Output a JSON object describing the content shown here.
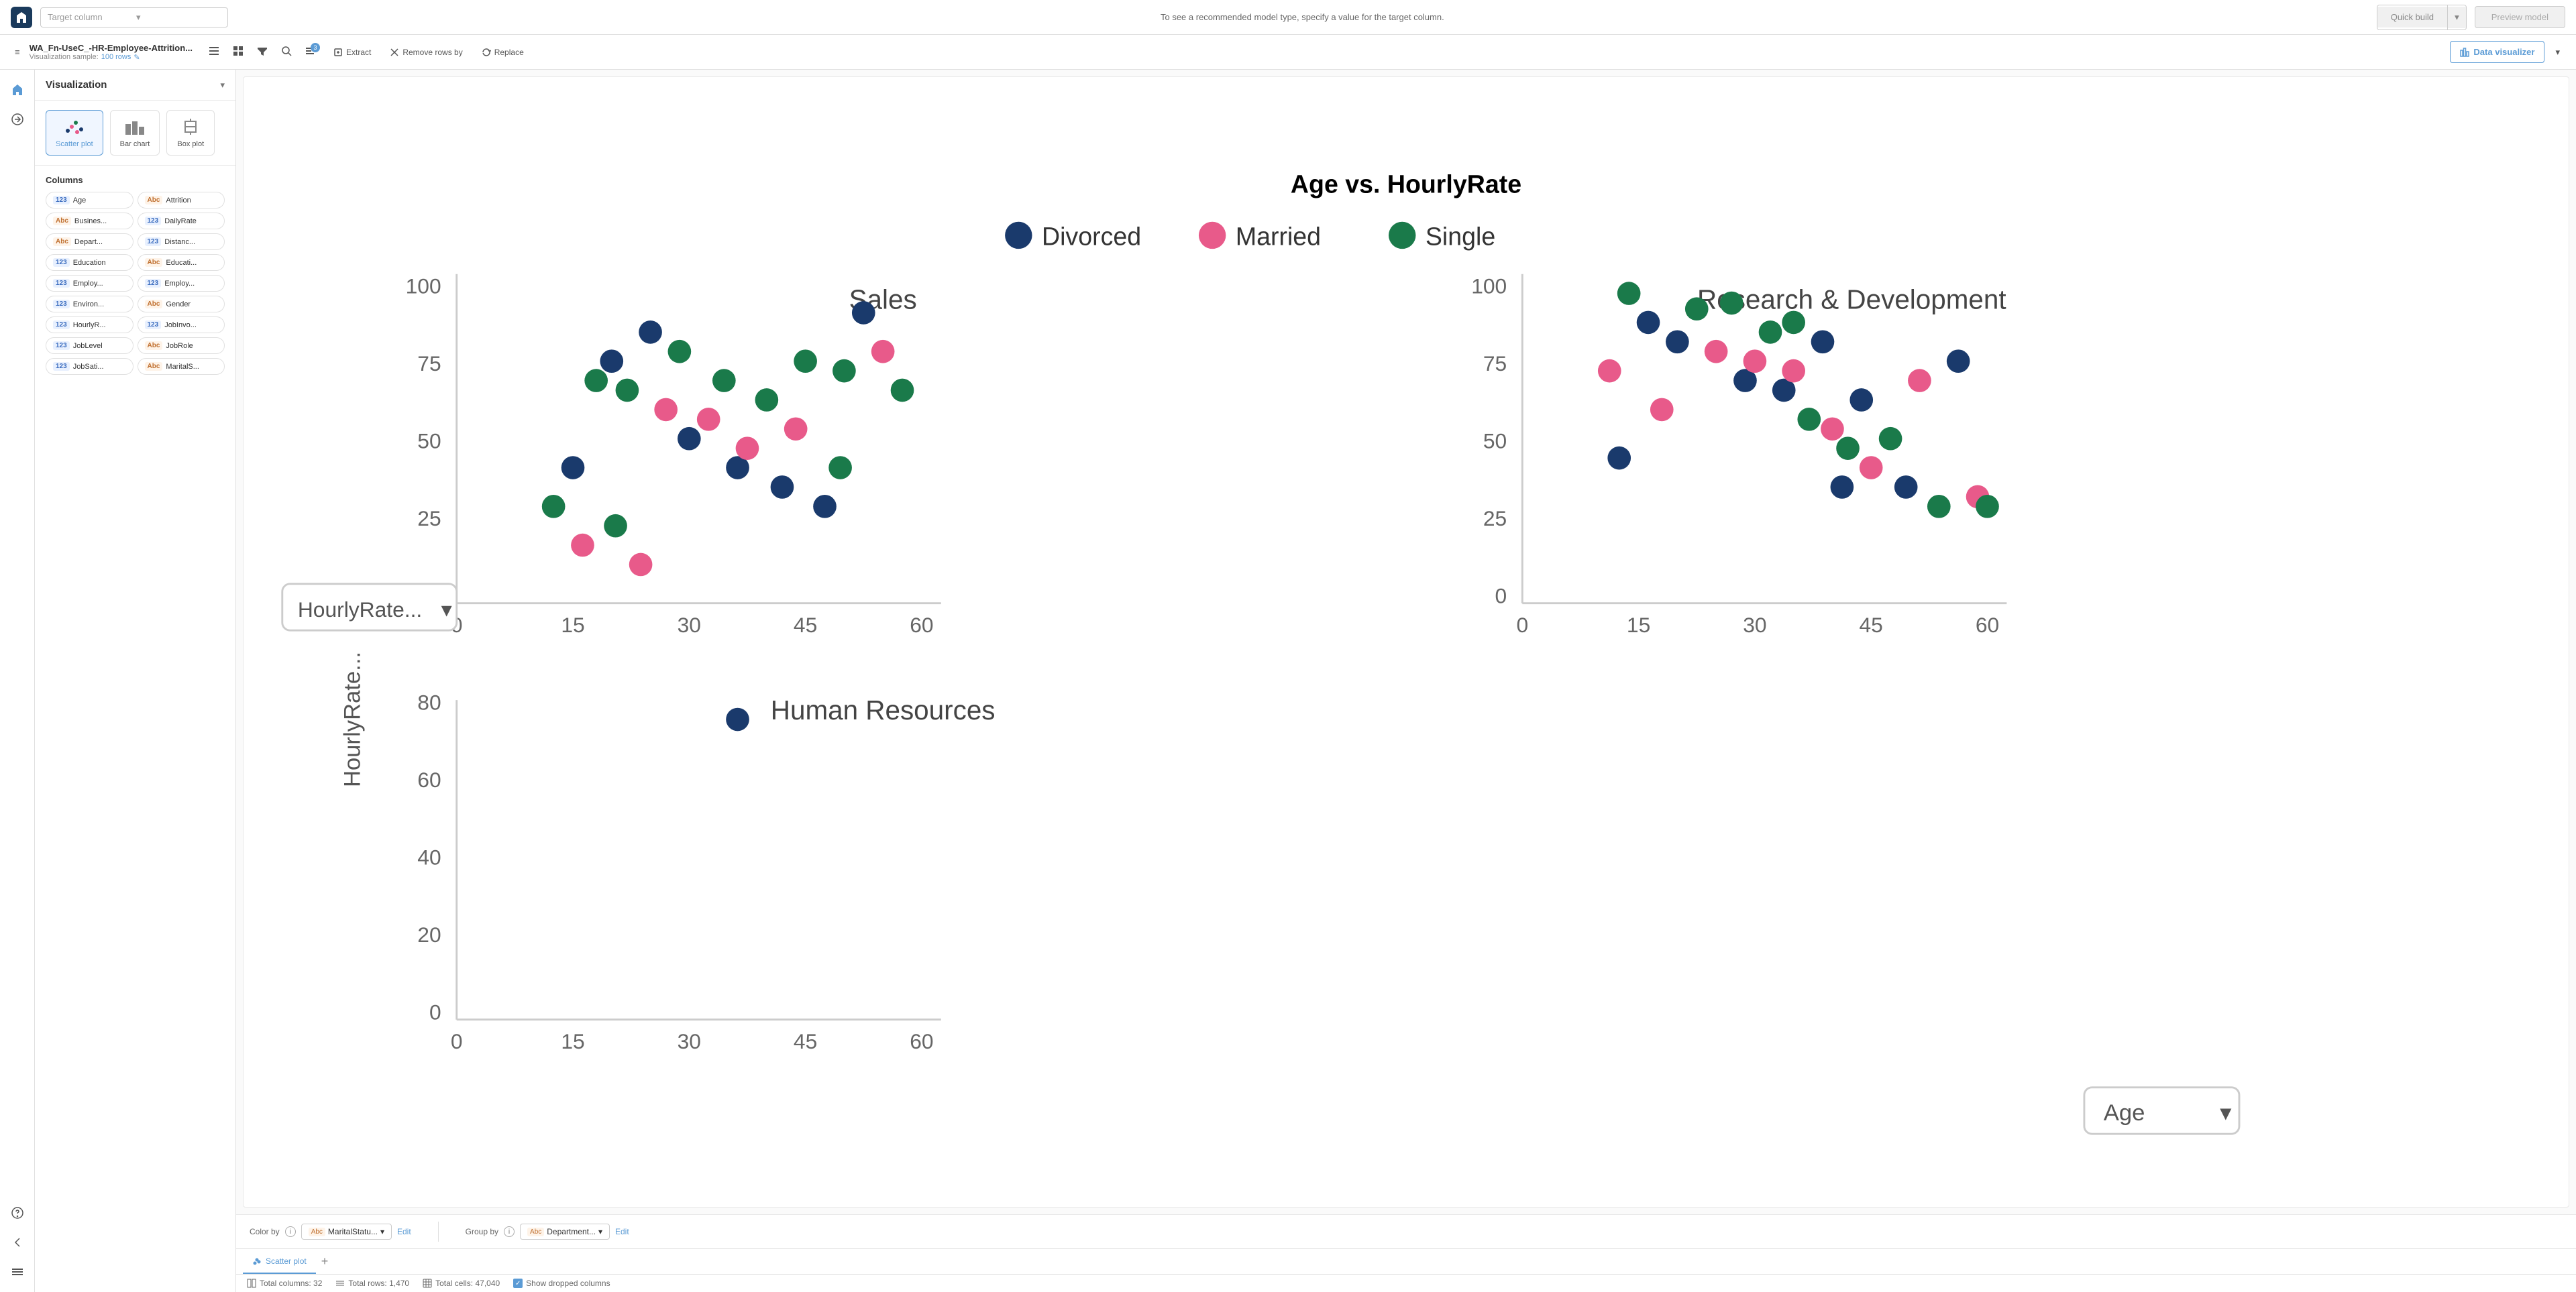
{
  "topBar": {
    "targetColumnPlaceholder": "Target column",
    "targetHint": "To see a recommended model type, specify a value for the target column.",
    "quickBuildLabel": "Quick build",
    "previewModelLabel": "Preview model"
  },
  "secondBar": {
    "fileName": "WA_Fn-UseC_-HR-Employee-Attrition...",
    "visualizationSample": "Visualization sample:",
    "sampleRows": "100 rows",
    "extractLabel": "Extract",
    "removeRowsByLabel": "Remove rows by",
    "replaceLabel": "Replace",
    "dataVisualizerLabel": "Data visualizer"
  },
  "leftPanel": {
    "title": "Visualization",
    "vizTypes": [
      {
        "id": "scatter",
        "label": "Scatter plot",
        "active": true
      },
      {
        "id": "bar",
        "label": "Bar chart",
        "active": false
      },
      {
        "id": "box",
        "label": "Box plot",
        "active": false
      }
    ],
    "columnsTitle": "Columns",
    "columns": [
      {
        "type": "num",
        "label": "Age",
        "typeLabel": "123"
      },
      {
        "type": "abc",
        "label": "Attrition",
        "typeLabel": "Abc"
      },
      {
        "type": "abc",
        "label": "Busines...",
        "typeLabel": "Abc"
      },
      {
        "type": "num",
        "label": "DailyRate",
        "typeLabel": "123"
      },
      {
        "type": "abc",
        "label": "Depart...",
        "typeLabel": "Abc"
      },
      {
        "type": "num",
        "label": "Distanc...",
        "typeLabel": "123"
      },
      {
        "type": "num",
        "label": "Education",
        "typeLabel": "123"
      },
      {
        "type": "abc",
        "label": "Educati...",
        "typeLabel": "Abc"
      },
      {
        "type": "num",
        "label": "Employ...",
        "typeLabel": "123"
      },
      {
        "type": "num",
        "label": "Employ...",
        "typeLabel": "123"
      },
      {
        "type": "num",
        "label": "Environ...",
        "typeLabel": "123"
      },
      {
        "type": "abc",
        "label": "Gender",
        "typeLabel": "Abc"
      },
      {
        "type": "num",
        "label": "HourlyR...",
        "typeLabel": "123"
      },
      {
        "type": "num",
        "label": "JobInvo...",
        "typeLabel": "123"
      },
      {
        "type": "num",
        "label": "JobLevel",
        "typeLabel": "123"
      },
      {
        "type": "abc",
        "label": "JobRole",
        "typeLabel": "Abc"
      },
      {
        "type": "num",
        "label": "JobSati...",
        "typeLabel": "123"
      },
      {
        "type": "abc",
        "label": "MaritalS...",
        "typeLabel": "Abc"
      }
    ]
  },
  "chart": {
    "title": "Age vs. HourlyRate",
    "legend": [
      {
        "label": "Divorced",
        "color": "#1a3a6c"
      },
      {
        "label": "Married",
        "color": "#e85a8a"
      },
      {
        "label": "Single",
        "color": "#1a7a4a"
      }
    ],
    "subCharts": [
      {
        "id": "sales",
        "label": "Sales"
      },
      {
        "id": "research",
        "label": "Research & Development"
      },
      {
        "id": "hr",
        "label": "Human Resources"
      }
    ],
    "yAxisLabel": "HourlyRate...",
    "xAxisLabel": "Age",
    "xTicks": [
      "0",
      "15",
      "30",
      "45",
      "60"
    ],
    "yTicks": [
      "0",
      "25",
      "50",
      "75",
      "100"
    ]
  },
  "bottomControls": {
    "colorByLabel": "Color by",
    "colorByValue": "MaritalStatu...",
    "colorByEditLabel": "Edit",
    "groupByLabel": "Group by",
    "groupByValue": "Department...",
    "groupByEditLabel": "Edit"
  },
  "tabs": [
    {
      "label": "Scatter plot",
      "active": true,
      "icon": "scatter"
    }
  ],
  "statusBar": {
    "totalColumns": "Total columns: 32",
    "totalRows": "Total rows: 1,470",
    "totalCells": "Total cells: 47,040",
    "showDroppedLabel": "Show dropped columns"
  },
  "icons": {
    "chevronDown": "▾",
    "plus": "+",
    "checkmark": "✓"
  }
}
